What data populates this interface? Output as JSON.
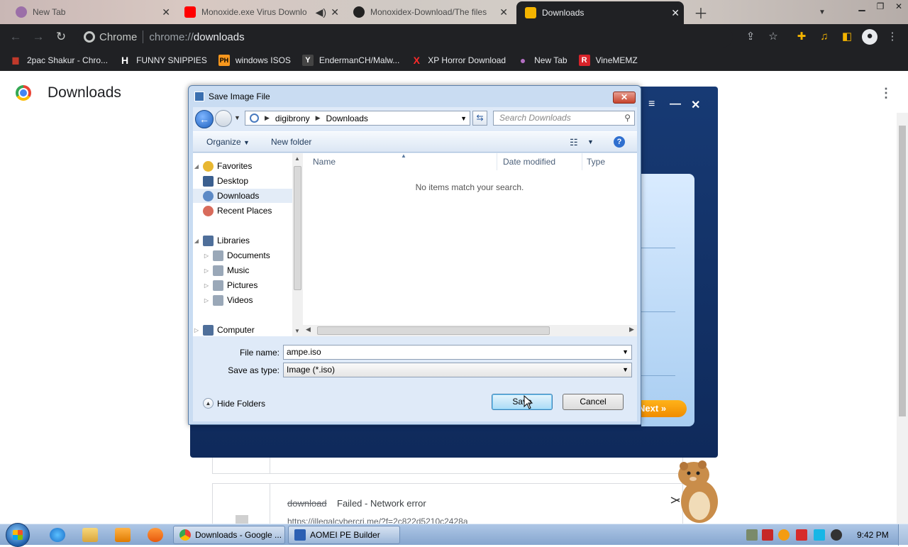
{
  "browser": {
    "tabs": [
      {
        "title": "New Tab",
        "favicon_color": "#9b6fa8"
      },
      {
        "title": "Monoxide.exe Virus Downlo",
        "favicon_color": "#ff0000"
      },
      {
        "title": "Monoxidex-Download/The files",
        "favicon_color": "#222222"
      },
      {
        "title": "Downloads",
        "favicon_color": "#f4b400",
        "active": true
      }
    ],
    "omnibox": {
      "scheme_label": "Chrome",
      "url_prefix": "chrome://",
      "url_host": "downloads"
    },
    "bookmarks": [
      {
        "label": "2pac Shakur - Chro...",
        "icon": "flag-icon",
        "icon_text": "▆",
        "color": "#c0392b"
      },
      {
        "label": "FUNNY SNIPPIES",
        "icon": "h-icon",
        "icon_text": "H",
        "color": "#ffffff"
      },
      {
        "label": "windows ISOS",
        "icon": "ph-icon",
        "icon_text": "PH",
        "color": "#f7971d"
      },
      {
        "label": "EndermanCH/Malw...",
        "icon": "y-icon",
        "icon_text": "Y",
        "color": "#444444"
      },
      {
        "label": "XP Horror Download",
        "icon": "x-icon",
        "icon_text": "X",
        "color": "#ff2a2a"
      },
      {
        "label": "New Tab",
        "icon": "globe-icon",
        "icon_text": "●",
        "color": "#b46fc4"
      },
      {
        "label": "VineMEMZ",
        "icon": "r-icon",
        "icon_text": "R",
        "color": "#d8232a"
      }
    ]
  },
  "downloads_page": {
    "title": "Downloads",
    "items": [
      {
        "file_name": "download",
        "status": "Failed - Network error",
        "url": "https://illegalcybercri.me/?f=2c822d5210c2428a"
      }
    ]
  },
  "aomei": {
    "next_label": "Next",
    "next_chevron": "»"
  },
  "dialog": {
    "title": "Save Image File",
    "breadcrumb": [
      "digibrony",
      "Downloads"
    ],
    "search_placeholder": "Search Downloads",
    "organize_label": "Organize",
    "new_folder_label": "New folder",
    "nav": {
      "favorites": "Favorites",
      "desktop": "Desktop",
      "downloads": "Downloads",
      "recent_places": "Recent Places",
      "libraries": "Libraries",
      "documents": "Documents",
      "music": "Music",
      "pictures": "Pictures",
      "videos": "Videos",
      "computer": "Computer"
    },
    "columns": [
      "Name",
      "Date modified",
      "Type"
    ],
    "empty_message": "No items match your search.",
    "file_name_label": "File name:",
    "file_name_value": "ampe.iso",
    "save_type_label": "Save as type:",
    "save_type_value": "Image (*.iso)",
    "hide_folders_label": "Hide Folders",
    "save_label": "Save",
    "cancel_label": "Cancel"
  },
  "taskbar": {
    "apps": [
      {
        "label": "Downloads - Google ...",
        "color": "#f4b400"
      },
      {
        "label": "AOMEI PE Builder",
        "color": "#2b5fb3"
      }
    ],
    "clock": "9:42 PM"
  }
}
